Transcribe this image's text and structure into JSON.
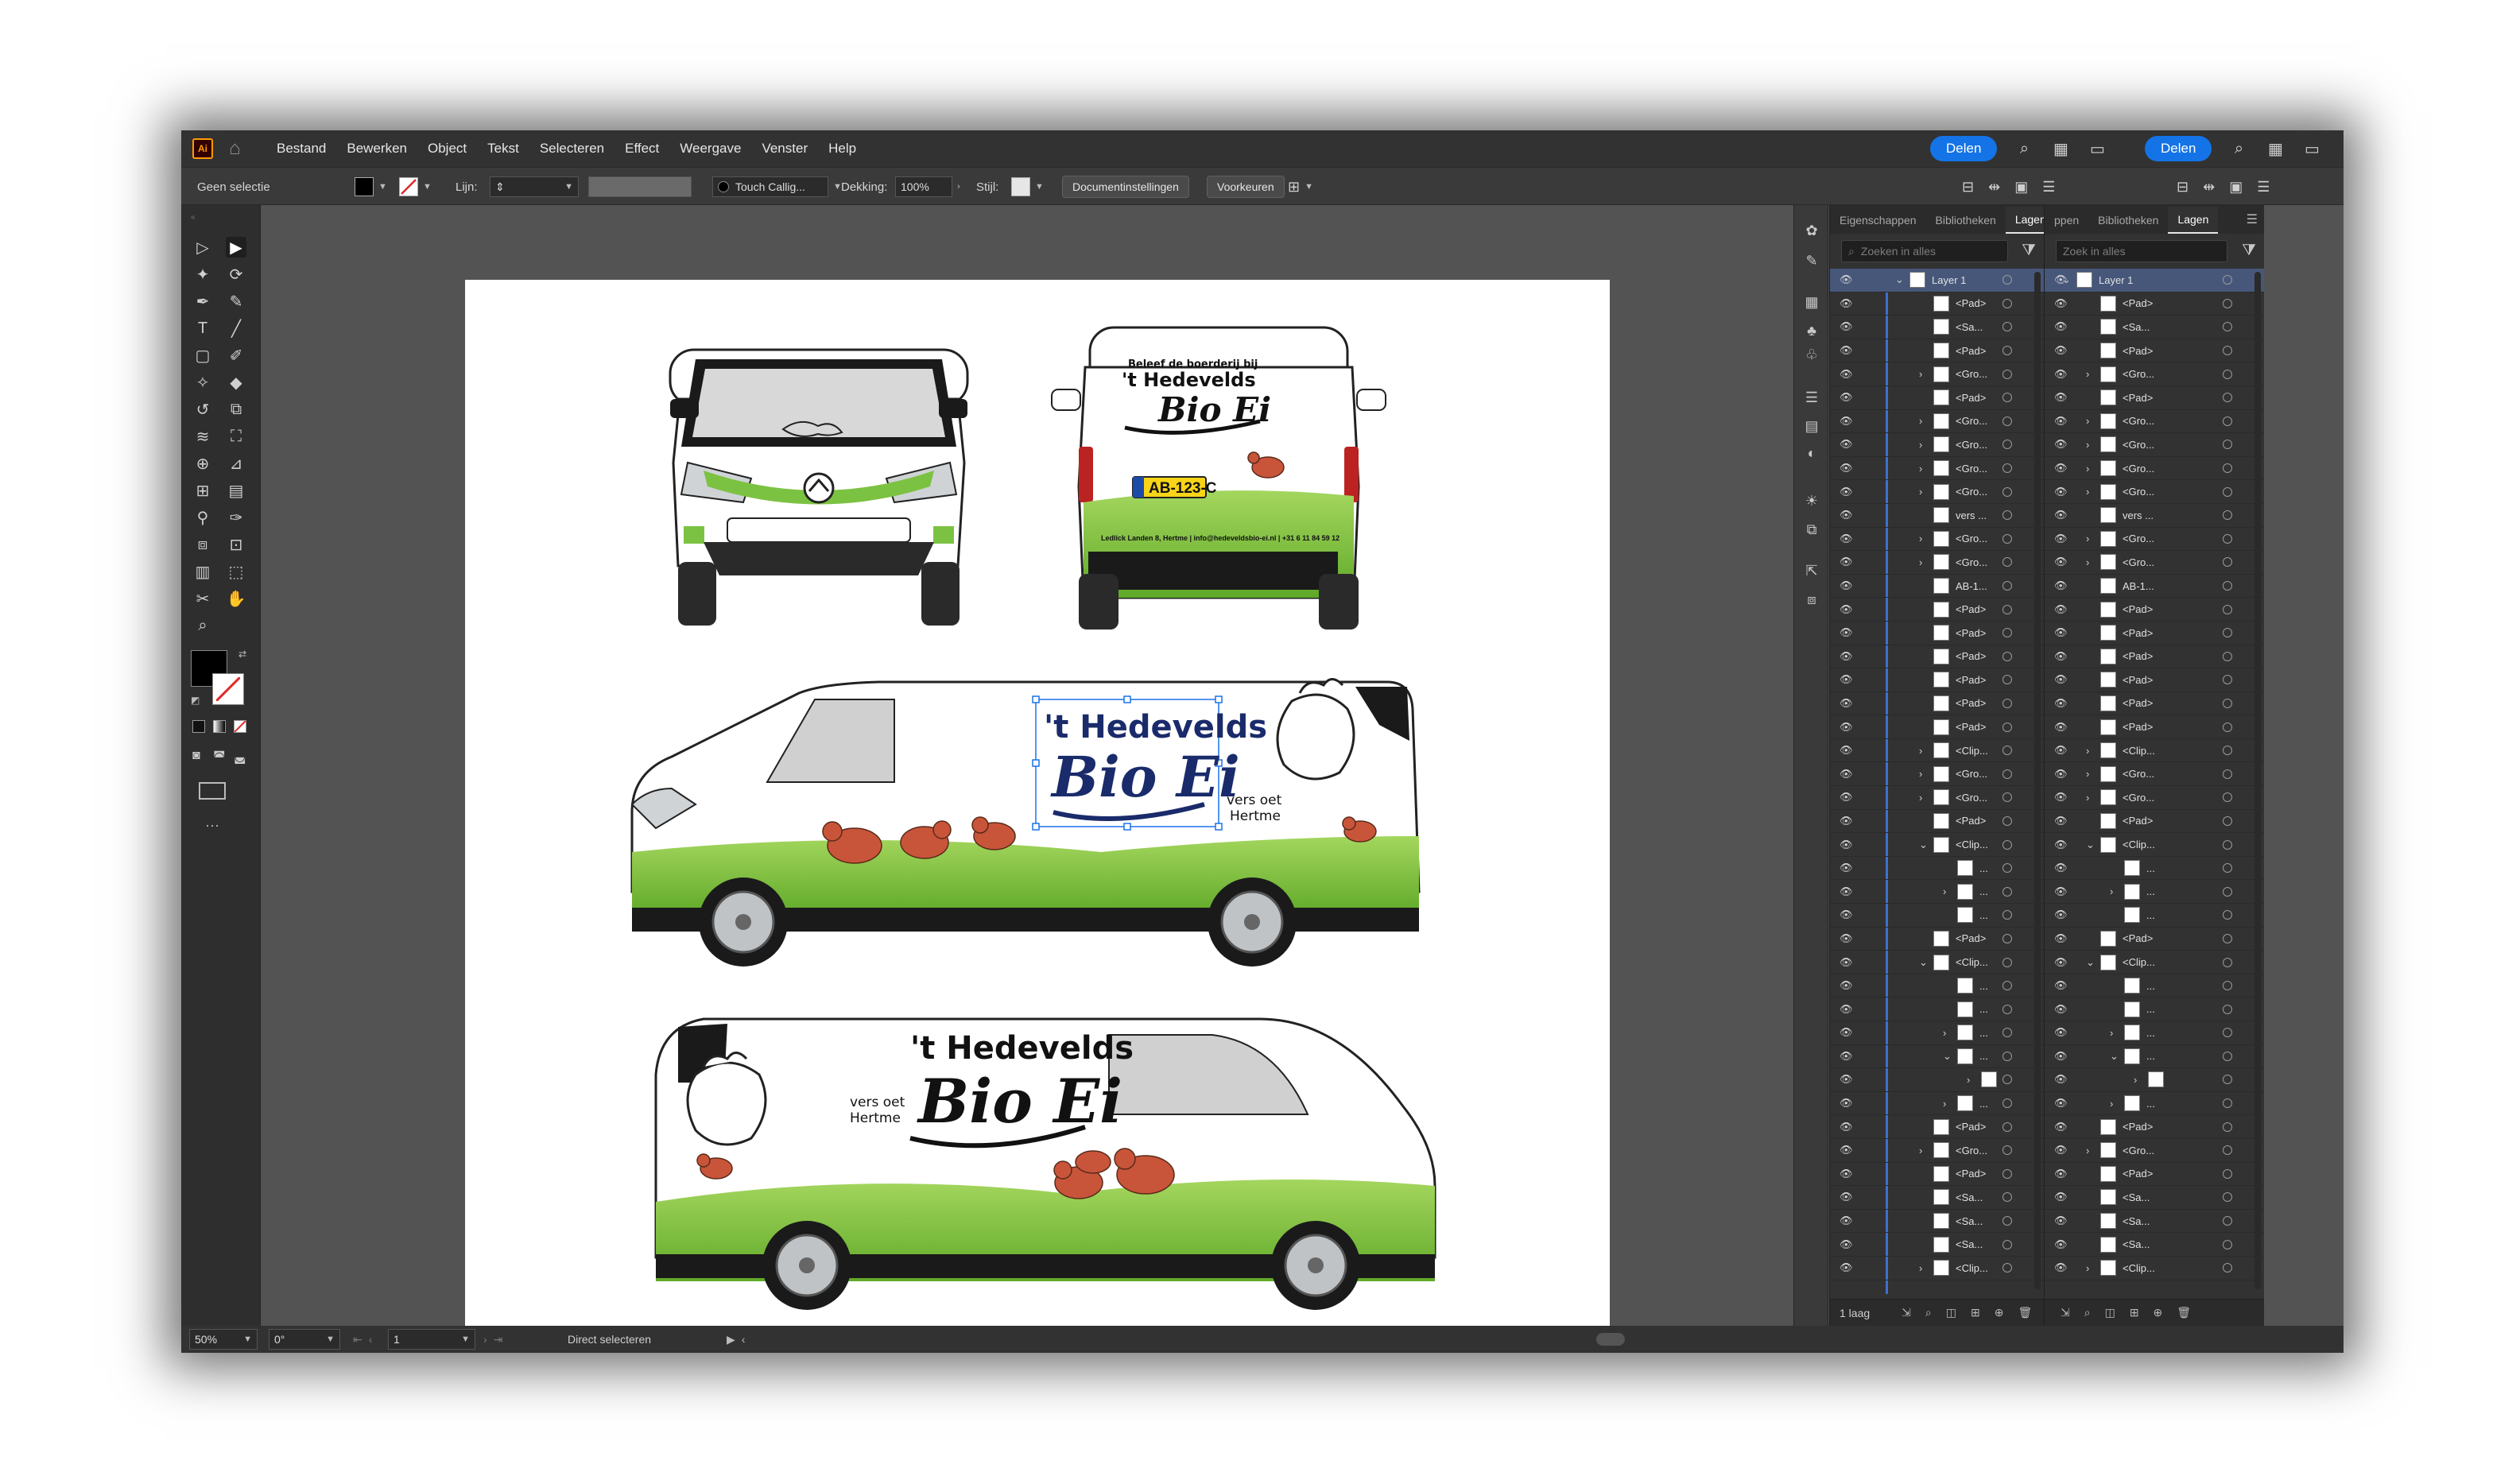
{
  "menubar": {
    "logo": "Ai",
    "items": [
      "Bestand",
      "Bewerken",
      "Object",
      "Tekst",
      "Selecteren",
      "Effect",
      "Weergave",
      "Venster",
      "Help"
    ],
    "share_label": "Delen",
    "share_label_2": "Delen"
  },
  "controlbar": {
    "selection": "Geen selectie",
    "stroke_label": "Lijn:",
    "brush": "Touch Callig...",
    "opacity_label": "Dekking:",
    "opacity_value": "100%",
    "style_label": "Stijl:",
    "doc_settings": "Documentinstellingen",
    "preferences": "Voorkeuren"
  },
  "artwork": {
    "brand_top": "'t Hedevelds",
    "brand_main": "Bio Ei",
    "tagline_1": "vers oet",
    "tagline_2": "Hertme",
    "rear_line_1": "Beleef de boerderij bij",
    "rear_line_2": "'t Hedevelds",
    "rear_main": "Bio Ei",
    "plate": "AB-123-C",
    "rear_footer": "Ledlick Landen 8, Hertme | info@hedeveldsbio-ei.nl | +31 6 11 84 59 12"
  },
  "panels": {
    "left": {
      "tabs": [
        "Eigenschappen",
        "Bibliotheken",
        "Lagen"
      ],
      "active_tab": "Lagen",
      "search_placeholder": "Zoeken in alles",
      "footer": "1 laag"
    },
    "right": {
      "tabs": [
        "ppen",
        "Bibliotheken",
        "Lagen"
      ],
      "active_tab": "Lagen",
      "search_placeholder": "Zoek in alles"
    },
    "layers": [
      {
        "name": "Layer 1",
        "level": 0,
        "expanded": true
      },
      {
        "name": "<Pad>",
        "level": 1
      },
      {
        "name": "<Sa...",
        "level": 1
      },
      {
        "name": "<Pad>",
        "level": 1
      },
      {
        "name": "<Gro...",
        "level": 1,
        "collapsed": true
      },
      {
        "name": "<Pad>",
        "level": 1
      },
      {
        "name": "<Gro...",
        "level": 1,
        "collapsed": true
      },
      {
        "name": "<Gro...",
        "level": 1,
        "collapsed": true
      },
      {
        "name": "<Gro...",
        "level": 1,
        "collapsed": true
      },
      {
        "name": "<Gro...",
        "level": 1,
        "collapsed": true
      },
      {
        "name": "vers ...",
        "level": 1
      },
      {
        "name": "<Gro...",
        "level": 1,
        "collapsed": true
      },
      {
        "name": "<Gro...",
        "level": 1,
        "collapsed": true
      },
      {
        "name": "AB-1...",
        "level": 1
      },
      {
        "name": "<Pad>",
        "level": 1
      },
      {
        "name": "<Pad>",
        "level": 1
      },
      {
        "name": "<Pad>",
        "level": 1
      },
      {
        "name": "<Pad>",
        "level": 1
      },
      {
        "name": "<Pad>",
        "level": 1
      },
      {
        "name": "<Pad>",
        "level": 1
      },
      {
        "name": "<Clip...",
        "level": 1,
        "collapsed": true
      },
      {
        "name": "<Gro...",
        "level": 1,
        "collapsed": true
      },
      {
        "name": "<Gro...",
        "level": 1,
        "collapsed": true
      },
      {
        "name": "<Pad>",
        "level": 1
      },
      {
        "name": "<Clip...",
        "level": 1,
        "expanded": true
      },
      {
        "name": "...",
        "level": 2
      },
      {
        "name": "...",
        "level": 2,
        "collapsed": true
      },
      {
        "name": "...",
        "level": 2
      },
      {
        "name": "<Pad>",
        "level": 1
      },
      {
        "name": "<Clip...",
        "level": 1,
        "expanded": true
      },
      {
        "name": "...",
        "level": 2
      },
      {
        "name": "...",
        "level": 2
      },
      {
        "name": "...",
        "level": 2,
        "collapsed": true
      },
      {
        "name": "...",
        "level": 2,
        "expanded": true
      },
      {
        "name": "",
        "level": 3,
        "collapsed": true
      },
      {
        "name": "...",
        "level": 2,
        "collapsed": true
      },
      {
        "name": "<Pad>",
        "level": 1
      },
      {
        "name": "<Gro...",
        "level": 1,
        "collapsed": true
      },
      {
        "name": "<Pad>",
        "level": 1
      },
      {
        "name": "<Sa...",
        "level": 1
      },
      {
        "name": "<Sa...",
        "level": 1
      },
      {
        "name": "<Sa...",
        "level": 1
      },
      {
        "name": "<Clip...",
        "level": 1,
        "collapsed": true
      }
    ]
  },
  "statusbar": {
    "zoom": "50%",
    "rotation": "0°",
    "artboard": "1",
    "tool": "Direct selecteren"
  },
  "colors": {
    "accent": "#1473e6",
    "grass": "#7cc242",
    "brand_blue": "#1a2b6b",
    "hen": "#c8553a"
  }
}
